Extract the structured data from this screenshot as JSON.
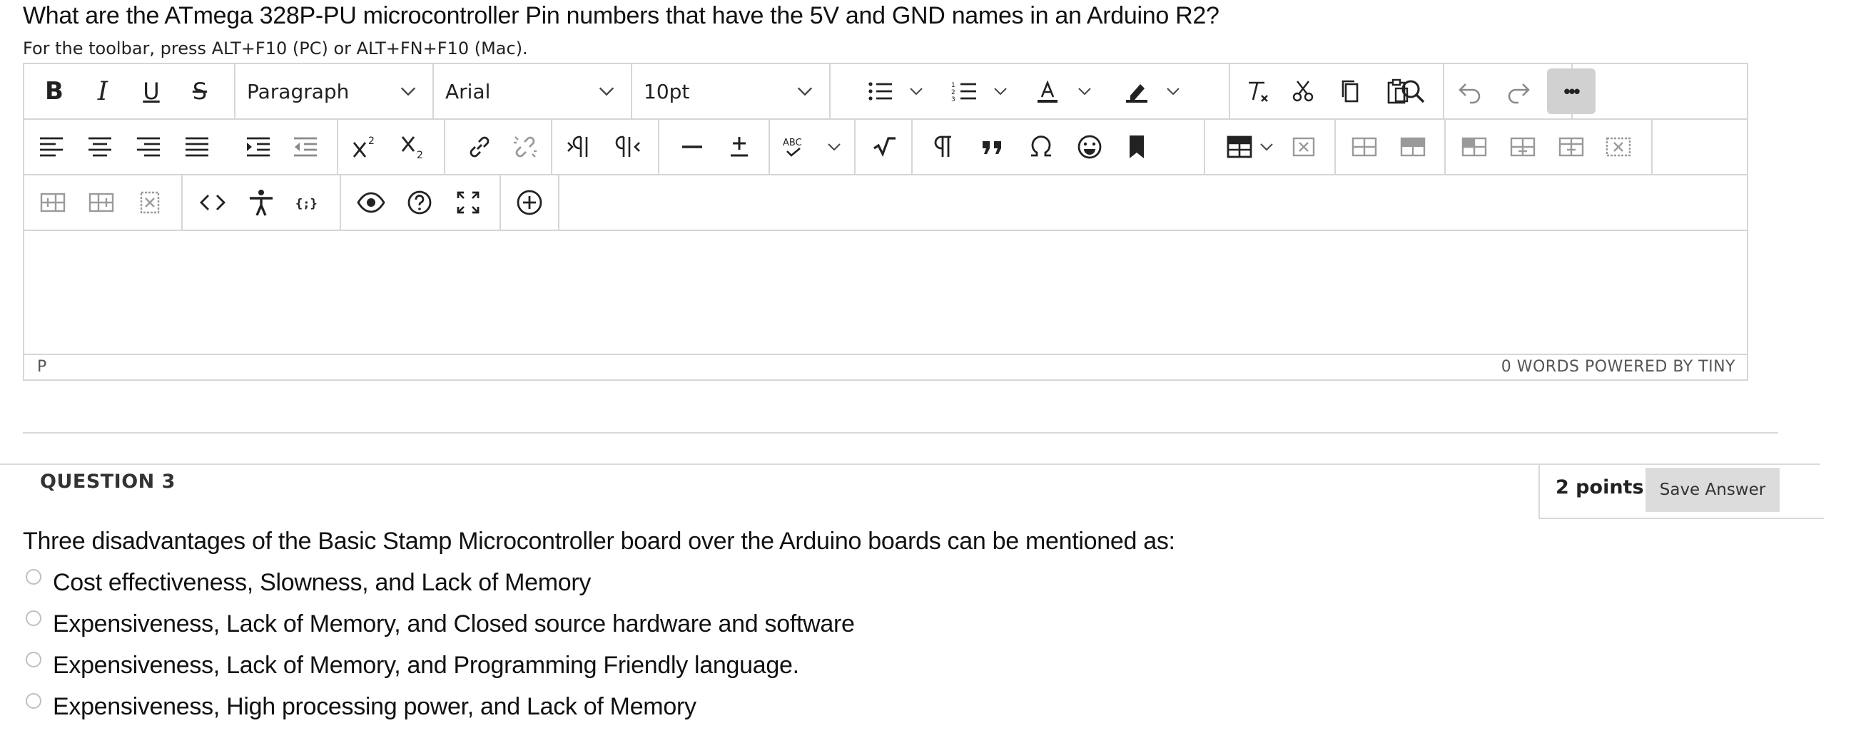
{
  "question2": {
    "title": "What are the ATmega 328P-PU microcontroller Pin numbers that have the 5V and GND names in an Arduino R2?",
    "toolbar_hint": "For the toolbar, press ALT+F10 (PC) or ALT+FN+F10 (Mac)."
  },
  "editor": {
    "block_format": "Paragraph",
    "font_family": "Arial",
    "font_size": "10pt",
    "bold_label": "B",
    "italic_label": "I",
    "underline_label": "U",
    "strike_label": "S",
    "status_path": "P",
    "status_right": "0 WORDS  POWERED BY TINY",
    "more_label": "•••"
  },
  "question3": {
    "label": "QUESTION 3",
    "points": "2 points",
    "save_label": "Save Answer",
    "text": "Three disadvantages of the Basic Stamp Microcontroller board over the Arduino boards can be mentioned as:",
    "options": [
      "Cost effectiveness, Slowness, and Lack of Memory",
      "Expensiveness, Lack of Memory, and Closed source hardware and software",
      "Expensiveness, Lack of Memory, and Programming Friendly language.",
      "Expensiveness, High processing power, and Lack of Memory"
    ]
  },
  "colors": {
    "border": "#d6d6d6",
    "button_bg": "#dcdcdc",
    "more_bg": "#d1d1d1",
    "text": "#111111"
  }
}
